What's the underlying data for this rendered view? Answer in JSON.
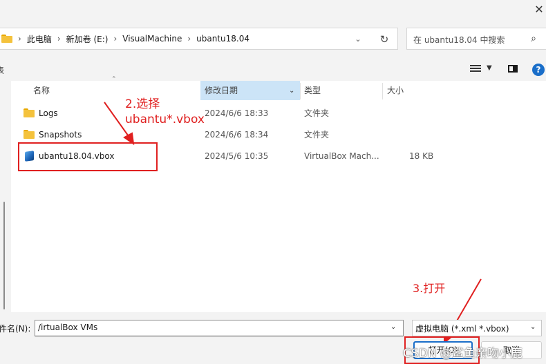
{
  "window": {
    "close_glyph": "✕"
  },
  "address_bar": {
    "crumbs": [
      "此电脑",
      "新加卷 (E:)",
      "VisualMachine",
      "ubantu18.04"
    ],
    "separator": "›",
    "icons": {
      "folder": "folder-icon",
      "chevron": "chevron-down-icon",
      "refresh": "refresh-icon"
    }
  },
  "search": {
    "placeholder": "在 ubantu18.04 中搜索",
    "icon": "search-icon"
  },
  "toolbar": {
    "left_text": "表",
    "icons": [
      "view-list-icon",
      "preview-pane-icon",
      "help-icon"
    ],
    "help_label": "?"
  },
  "columns": {
    "name": "名称",
    "date": "修改日期",
    "type": "类型",
    "size": "大小"
  },
  "files": [
    {
      "name": "Logs",
      "date": "2024/6/6 18:33",
      "type": "文件夹",
      "size": "",
      "icon": "folder-icon"
    },
    {
      "name": "Snapshots",
      "date": "2024/6/6 18:34",
      "type": "文件夹",
      "size": "",
      "icon": "folder-icon"
    },
    {
      "name": "ubantu18.04.vbox",
      "date": "2024/5/6 10:35",
      "type": "VirtualBox Mach...",
      "size": "18 KB",
      "icon": "vbox-file-icon"
    }
  ],
  "annotations": {
    "step2_line1": "2.选择",
    "step2_line2": "ubantu*.vbox",
    "step3": "3.打开",
    "color": "#e02020"
  },
  "bottom": {
    "filename_label": "件名(N):",
    "filename_value": "/irtualBox VMs",
    "filter_value": "虚拟电脑 (*.xml *.vbox)",
    "open_label": "打开(O)",
    "cancel_label": "取消"
  },
  "watermark": "CSDN @鲨鱼亲吻小鹿",
  "colors": {
    "accent": "#1a6ec9",
    "selected_column": "#cce4f7",
    "folder": "#f4c23c"
  }
}
